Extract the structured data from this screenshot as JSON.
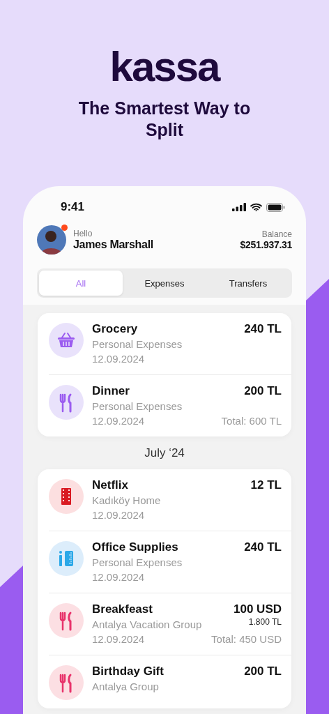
{
  "brand": {
    "logo": "kassa",
    "tagline": "The Smartest Way to Split"
  },
  "status_bar": {
    "time": "9:41"
  },
  "header": {
    "greeting": "Hello",
    "name": "James Marshall",
    "notification": true,
    "balance_label": "Balance",
    "balance": "$251.937.31"
  },
  "tabs": [
    {
      "label": "All",
      "selected": true
    },
    {
      "label": "Expenses",
      "selected": false
    },
    {
      "label": "Transfers",
      "selected": false
    }
  ],
  "groups": [
    {
      "items": [
        {
          "kind": "basket",
          "color": "#9b5cf0",
          "title": "Grocery",
          "subtitle": "Personal Expenses",
          "date": "12.09.2024",
          "amount": "240 TL"
        },
        {
          "kind": "cutlery",
          "color": "#9b5cf0",
          "title": "Dinner",
          "subtitle": "Personal Expenses",
          "date": "12.09.2024",
          "amount": "200 TL",
          "total": "Total: 600 TL"
        }
      ]
    },
    {
      "heading": "July ‘24",
      "items": [
        {
          "kind": "film",
          "color": "#d91a22",
          "title": "Netflix",
          "subtitle": "Kadıköy Home",
          "date": "12.09.2024",
          "amount": "12 TL"
        },
        {
          "kind": "ruler",
          "color": "#2aa8e8",
          "title": "Office Supplies",
          "subtitle": "Personal Expenses",
          "date": "12.09.2024",
          "amount": "240 TL"
        },
        {
          "kind": "cutlery",
          "color": "#e8336b",
          "title": "Breakfeast",
          "subtitle": "Antalya Vacation Group",
          "date": "12.09.2024",
          "amount": "100 USD",
          "amount_secondary": "1.800 TL",
          "total": "Total: 450 USD"
        },
        {
          "kind": "cutlery",
          "color": "#e8336b",
          "title": "Birthday Gift",
          "subtitle": "Antalya Group",
          "amount": "200 TL"
        }
      ]
    }
  ]
}
